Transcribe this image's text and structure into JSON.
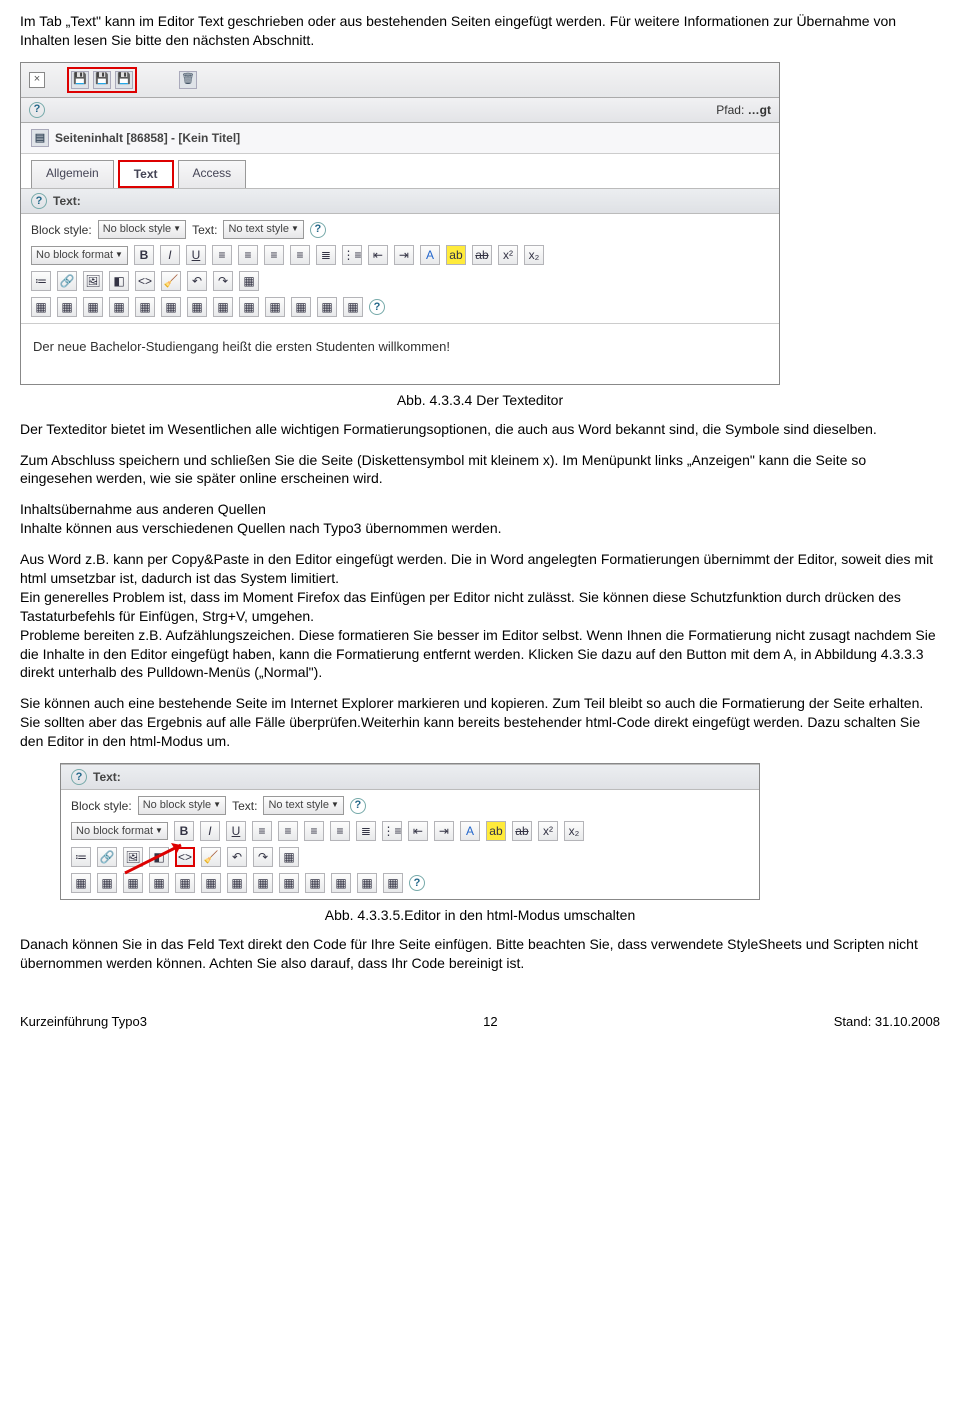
{
  "p1": "Im Tab „Text\" kann im Editor Text geschrieben oder aus bestehenden Seiten eingefügt werden. Für weitere Informationen zur Übernahme von Inhalten lesen Sie bitte den nächsten Abschnitt.",
  "screenshot1": {
    "path_label": "Pfad:",
    "path_value": "…gt",
    "title": "Seiteninhalt [86858] - [Kein Titel]",
    "tabs": {
      "t1": "Allgemein",
      "t2": "Text",
      "t3": "Access"
    },
    "section": "Text:",
    "block_style_label": "Block style:",
    "block_style_value": "No block style",
    "text_label": "Text:",
    "text_value": "No text style",
    "block_format": "No block format",
    "editor_text": "Der neue Bachelor-Studiengang heißt die ersten Studenten willkommen!"
  },
  "caption1": "Abb. 4.3.3.4 Der Texteditor",
  "p2": "Der Texteditor bietet im Wesentlichen alle wichtigen Formatierungsoptionen, die auch aus Word bekannt sind, die Symbole sind dieselben.",
  "p3": "Zum Abschluss speichern und schließen Sie die Seite (Diskettensymbol mit kleinem x). Im Menüpunkt links „Anzeigen\" kann die Seite so eingesehen werden, wie sie später online erscheinen wird.",
  "p4a": "Inhaltsübernahme aus anderen Quellen",
  "p4b": "Inhalte können aus verschiedenen Quellen nach Typo3 übernommen werden.",
  "p5": "Aus Word z.B. kann per Copy&Paste in den Editor eingefügt werden. Die in Word angelegten Formatierungen übernimmt der Editor, soweit dies mit html umsetzbar ist, dadurch ist das System limitiert.",
  "p6": "Ein generelles Problem ist, dass im Moment Firefox das Einfügen per Editor nicht zulässt. Sie können diese Schutzfunktion durch drücken des Tastaturbefehls für Einfügen, Strg+V, umgehen.",
  "p7": "Probleme bereiten z.B. Aufzählungszeichen. Diese formatieren Sie besser im Editor selbst. Wenn Ihnen die Formatierung nicht zusagt nachdem Sie die Inhalte in den Editor eingefügt haben, kann die Formatierung entfernt werden. Klicken Sie dazu auf den Button mit dem A, in Abbildung 4.3.3.3 direkt unterhalb des Pulldown-Menüs („Normal\").",
  "p8": "Sie können auch eine bestehende Seite im Internet Explorer markieren und kopieren. Zum Teil bleibt so auch die Formatierung der Seite erhalten. Sie sollten aber das Ergebnis auf alle Fälle überprüfen.Weiterhin kann bereits bestehender html-Code direkt eingefügt werden. Dazu schalten Sie den Editor in den html-Modus um.",
  "screenshot2": {
    "section": "Text:",
    "block_style_label": "Block style:",
    "block_style_value": "No block style",
    "text_label": "Text:",
    "text_value": "No text style",
    "block_format": "No block format"
  },
  "caption2": "Abb. 4.3.3.5.Editor in den html-Modus umschalten",
  "p9": "Danach können Sie in das Feld Text direkt den Code für Ihre Seite einfügen. Bitte beachten Sie, dass verwendete StyleSheets und Scripten nicht übernommen werden können. Achten Sie also darauf, dass Ihr Code bereinigt ist.",
  "footer": {
    "left": "Kurzeinführung Typo3",
    "center": "12",
    "right": "Stand: 31.10.2008"
  }
}
